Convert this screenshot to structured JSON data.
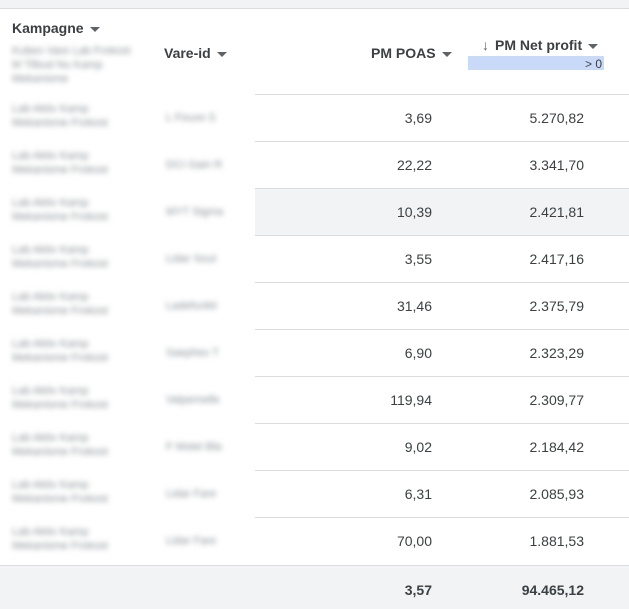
{
  "headers": {
    "campaign": "Kampagne",
    "item_id": "Vare-id",
    "poas": "PM POAS",
    "net_profit": "PM Net profit"
  },
  "sort_arrow": "↓",
  "filter_label": "> 0",
  "header_campaign_blur": "Kuben Vare Lab Frokost M Tilbud Nu Kamp Mekanisme",
  "rows": [
    {
      "campaign": "Lab Aktiv Kamp Mekanisme Frokost",
      "item_id": "L Fixure S",
      "poas": "3,69",
      "net_profit": "5.270,82"
    },
    {
      "campaign": "Lab Aktiv Kamp Mekanisme Frokost",
      "item_id": "DCI Gain R",
      "poas": "22,22",
      "net_profit": "3.341,70"
    },
    {
      "campaign": "Lab Aktiv Kamp Mekanisme Frokost",
      "item_id": "MYT Sigma",
      "poas": "10,39",
      "net_profit": "2.421,81"
    },
    {
      "campaign": "Lab Aktiv Kamp Mekanisme Frokost",
      "item_id": "Lidar Sout",
      "poas": "3,55",
      "net_profit": "2.417,16"
    },
    {
      "campaign": "Lab Aktiv Kamp Mekanisme Frokost",
      "item_id": "Ladefunkti",
      "poas": "31,46",
      "net_profit": "2.375,79"
    },
    {
      "campaign": "Lab Aktiv Kamp Mekanisme Frokost",
      "item_id": "Saephex T",
      "poas": "6,90",
      "net_profit": "2.323,29"
    },
    {
      "campaign": "Lab Aktiv Kamp Mekanisme Frokost",
      "item_id": "Valpemelle",
      "poas": "119,94",
      "net_profit": "2.309,77"
    },
    {
      "campaign": "Lab Aktiv Kamp Mekanisme Frokost",
      "item_id": "F Motel Bla",
      "poas": "9,02",
      "net_profit": "2.184,42"
    },
    {
      "campaign": "Lab Aktiv Kamp Mekanisme Frokost",
      "item_id": "Lidar Fare",
      "poas": "6,31",
      "net_profit": "2.085,93"
    },
    {
      "campaign": "Lab Aktiv Kamp Mekanisme Frokost",
      "item_id": "Lidar Fare",
      "poas": "70,00",
      "net_profit": "1.881,53"
    }
  ],
  "totals": {
    "poas": "3,57",
    "net_profit": "94.465,12"
  },
  "colors": {
    "filter_highlight": "#c9daf8",
    "row_highlight": "#f1f3f4",
    "footer_bg": "#f1f3f4"
  }
}
